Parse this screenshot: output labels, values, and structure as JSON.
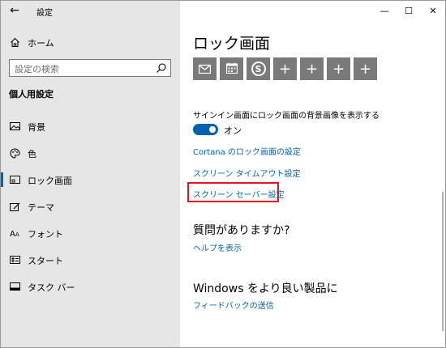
{
  "window": {
    "title": "設定",
    "controls": {
      "minimize": "—",
      "maximize": "☐",
      "close": "✕"
    }
  },
  "sidebar": {
    "back": "←",
    "home_label": "ホーム",
    "search_placeholder": "設定の検索",
    "section_title": "個人用設定",
    "items": [
      {
        "label": "背景",
        "icon": "picture-icon"
      },
      {
        "label": "色",
        "icon": "palette-icon"
      },
      {
        "label": "ロック画面",
        "icon": "lock-screen-icon",
        "active": true
      },
      {
        "label": "テーマ",
        "icon": "theme-icon"
      },
      {
        "label": "フォント",
        "icon": "font-icon"
      },
      {
        "label": "スタート",
        "icon": "start-icon"
      },
      {
        "label": "タスク バー",
        "icon": "taskbar-icon"
      }
    ]
  },
  "main": {
    "title": "ロック画面",
    "tiles": [
      {
        "icon": "mail-icon"
      },
      {
        "icon": "calendar-icon"
      },
      {
        "icon": "skype-icon",
        "glyph": "S"
      },
      {
        "icon": "plus-icon",
        "glyph": "+"
      },
      {
        "icon": "plus-icon",
        "glyph": "+"
      },
      {
        "icon": "plus-icon",
        "glyph": "+"
      },
      {
        "icon": "plus-icon",
        "glyph": "+"
      }
    ],
    "toggle_label": "サインイン画面にロック画面の背景画像を表示する",
    "toggle_state": "オン",
    "toggle_on": true,
    "links": {
      "cortana": "Cortana のロック画面の設定",
      "timeout": "スクリーン タイムアウト設定",
      "screensaver": "スクリーン セーバー設定"
    },
    "questions_heading": "質問がありますか?",
    "help_link": "ヘルプを表示",
    "windows_heading": "Windows をより良い製品に",
    "feedback_link": "フィードバックの送信"
  },
  "colors": {
    "accent": "#0063b1",
    "highlight": "#e81123",
    "sidebar_bg": "#e6e6e6",
    "tile_bg": "#7a7a7a"
  }
}
